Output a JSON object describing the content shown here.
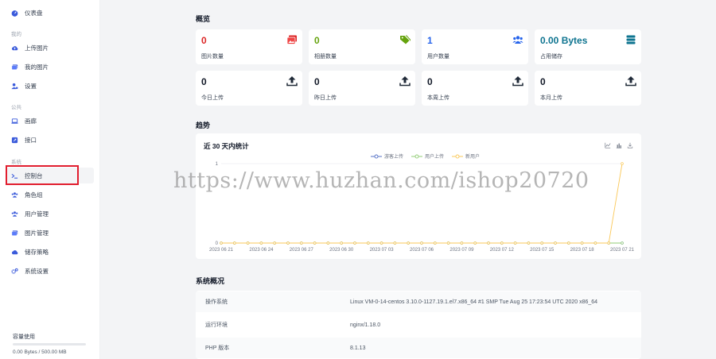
{
  "sidebar": {
    "dashboard": "仪表盘",
    "section_mine": "我的",
    "upload": "上传图片",
    "my_images": "我的图片",
    "settings": "设置",
    "section_public": "公共",
    "gallery": "画廊",
    "api": "接口",
    "section_system": "系统",
    "console": "控制台",
    "roles": "角色组",
    "users": "用户管理",
    "images": "图片管理",
    "storage_strategy": "储存策略",
    "system_settings": "系统设置",
    "storage_title": "容量使用",
    "storage_used_fraction": 0,
    "storage_text": "0.00 Bytes / 500.00 MB"
  },
  "overview": {
    "title": "概览",
    "cards": [
      {
        "value": "0",
        "label": "图片数量",
        "color": "#dc2626",
        "icon": "images-icon"
      },
      {
        "value": "0",
        "label": "相册数量",
        "color": "#65a30d",
        "icon": "tags-icon"
      },
      {
        "value": "1",
        "label": "用户数量",
        "color": "#2563eb",
        "icon": "users-icon"
      },
      {
        "value": "0.00 Bytes",
        "label": "占用储存",
        "color": "#0e7490",
        "icon": "database-icon"
      },
      {
        "value": "0",
        "label": "今日上传",
        "color": "#111827",
        "icon": "upload-icon"
      },
      {
        "value": "0",
        "label": "昨日上传",
        "color": "#111827",
        "icon": "upload-icon"
      },
      {
        "value": "0",
        "label": "本周上传",
        "color": "#111827",
        "icon": "upload-icon"
      },
      {
        "value": "0",
        "label": "本月上传",
        "color": "#111827",
        "icon": "upload-icon"
      }
    ]
  },
  "trend": {
    "title": "趋势",
    "chart_title": "近 30 天内统计"
  },
  "chart_data": {
    "type": "line",
    "title": "近 30 天内统计",
    "x": [
      "2023-06-21",
      "2023-06-22",
      "2023-06-23",
      "2023-06-24",
      "2023-06-25",
      "2023-06-26",
      "2023-06-27",
      "2023-06-28",
      "2023-06-29",
      "2023-06-30",
      "2023-07-01",
      "2023-07-02",
      "2023-07-03",
      "2023-07-04",
      "2023-07-05",
      "2023-07-06",
      "2023-07-07",
      "2023-07-08",
      "2023-07-09",
      "2023-07-10",
      "2023-07-11",
      "2023-07-12",
      "2023-07-13",
      "2023-07-14",
      "2023-07-15",
      "2023-07-16",
      "2023-07-17",
      "2023-07-18",
      "2023-07-19",
      "2023-07-20",
      "2023-07-21"
    ],
    "x_tick_labels": [
      "2023-06-21",
      "2023-06-24",
      "2023-06-27",
      "2023-06-30",
      "2023-07-03",
      "2023-07-06",
      "2023-07-09",
      "2023-07-12",
      "2023-07-15",
      "2023-07-18",
      "2023-07-21"
    ],
    "series": [
      {
        "name": "游客上传",
        "color": "#5470c6",
        "values": [
          0,
          0,
          0,
          0,
          0,
          0,
          0,
          0,
          0,
          0,
          0,
          0,
          0,
          0,
          0,
          0,
          0,
          0,
          0,
          0,
          0,
          0,
          0,
          0,
          0,
          0,
          0,
          0,
          0,
          0,
          0
        ]
      },
      {
        "name": "用户上传",
        "color": "#91cc75",
        "values": [
          0,
          0,
          0,
          0,
          0,
          0,
          0,
          0,
          0,
          0,
          0,
          0,
          0,
          0,
          0,
          0,
          0,
          0,
          0,
          0,
          0,
          0,
          0,
          0,
          0,
          0,
          0,
          0,
          0,
          0,
          0
        ]
      },
      {
        "name": "新用户",
        "color": "#fac858",
        "values": [
          0,
          0,
          0,
          0,
          0,
          0,
          0,
          0,
          0,
          0,
          0,
          0,
          0,
          0,
          0,
          0,
          0,
          0,
          0,
          0,
          0,
          0,
          0,
          0,
          0,
          0,
          0,
          0,
          0,
          0,
          1
        ]
      }
    ],
    "ylim": [
      0,
      1
    ],
    "y_tick_labels": [
      "0",
      "1"
    ],
    "legend": "top-center",
    "grid": true
  },
  "system": {
    "title": "系统概况",
    "rows": [
      {
        "key": "操作系统",
        "value": "Linux VM-0-14-centos 3.10.0-1127.19.1.el7.x86_64 #1 SMP Tue Aug 25 17:23:54 UTC 2020 x86_64"
      },
      {
        "key": "运行环境",
        "value": "nginx/1.18.0"
      },
      {
        "key": "PHP 版本",
        "value": "8.1.13"
      }
    ]
  },
  "watermark": "https://www.huzhan.com/ishop20720"
}
